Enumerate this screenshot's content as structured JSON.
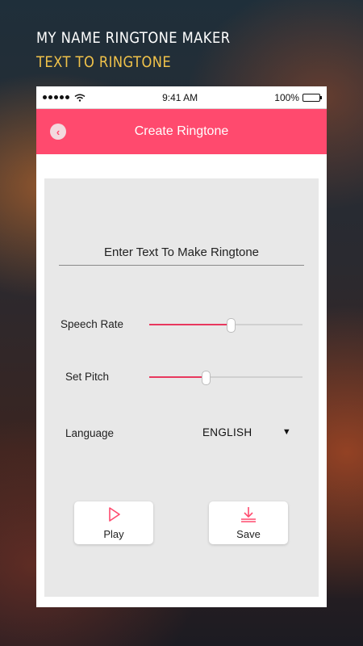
{
  "promo": {
    "title": "MY NAME RINGTONE MAKER",
    "subtitle": "TEXT TO RINGTONE"
  },
  "status_bar": {
    "time": "9:41 AM",
    "battery": "100%"
  },
  "app_bar": {
    "title": "Create Ringtone",
    "back_icon": "back-arrow-icon"
  },
  "form": {
    "text_input_placeholder": "Enter Text To Make Ringtone",
    "speech_rate": {
      "label": "Speech Rate",
      "value_fraction": 0.53
    },
    "pitch": {
      "label": "Set Pitch",
      "value_fraction": 0.37
    },
    "language": {
      "label": "Language",
      "selected": "ENGLISH"
    }
  },
  "buttons": {
    "play_label": "Play",
    "save_label": "Save"
  },
  "colors": {
    "accent": "#ff4a6e",
    "slider_fill": "#e8385e",
    "promo_subtitle": "#f0c24a"
  }
}
